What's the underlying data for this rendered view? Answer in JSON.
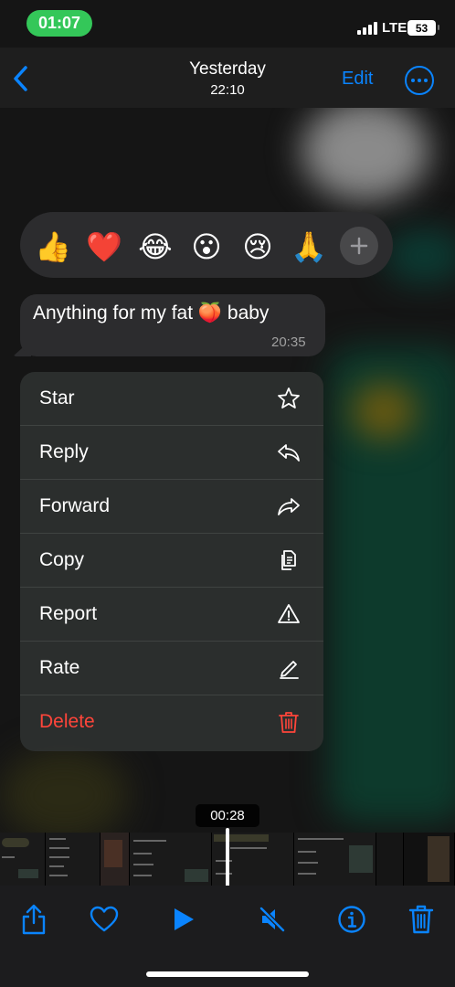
{
  "status_bar": {
    "time": "01:07",
    "network": "LTE",
    "battery": "53"
  },
  "header": {
    "title": "Yesterday",
    "subtitle": "22:10",
    "edit_label": "Edit",
    "back_icon": "chevron-left-icon",
    "more_icon": "ellipsis-circle-icon"
  },
  "reactions": {
    "emojis": [
      "👍",
      "❤️",
      "😂",
      "😮",
      "😢",
      "🙏"
    ],
    "more_icon": "plus-icon"
  },
  "message": {
    "text": "Anything for my fat 🍑 baby",
    "time": "20:35"
  },
  "context_menu": {
    "items": [
      {
        "label": "Star",
        "icon": "star-icon"
      },
      {
        "label": "Reply",
        "icon": "reply-icon"
      },
      {
        "label": "Forward",
        "icon": "forward-icon"
      },
      {
        "label": "Copy",
        "icon": "copy-icon"
      },
      {
        "label": "Report",
        "icon": "warning-icon"
      },
      {
        "label": "Rate",
        "icon": "pencil-icon"
      },
      {
        "label": "Delete",
        "icon": "trash-icon",
        "danger": true
      }
    ]
  },
  "video": {
    "current_time": "00:28"
  },
  "toolbar": {
    "buttons": [
      "share-icon",
      "heart-icon",
      "play-icon",
      "speaker-muted-icon",
      "info-icon",
      "trash-icon"
    ]
  },
  "colors": {
    "accent": "#0a84ff",
    "danger": "#ff453a",
    "status_pill": "#34c759"
  }
}
